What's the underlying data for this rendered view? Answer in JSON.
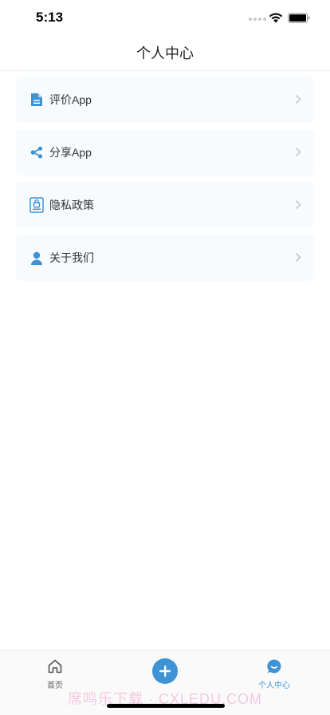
{
  "status": {
    "time": "5:13"
  },
  "nav": {
    "title": "个人中心"
  },
  "menu": [
    {
      "label": "评价App",
      "icon": "document-icon"
    },
    {
      "label": "分享App",
      "icon": "share-icon"
    },
    {
      "label": "隐私政策",
      "icon": "privacy-lock-icon"
    },
    {
      "label": "关于我们",
      "icon": "person-icon"
    }
  ],
  "tabs": {
    "home": "首页",
    "add": "add-icon",
    "profile": "个人中心"
  },
  "watermark": "席鸣乐下载 · CXLEDU.COM",
  "colors": {
    "accent": "#3d93d4",
    "card": "#f8fbfe"
  }
}
